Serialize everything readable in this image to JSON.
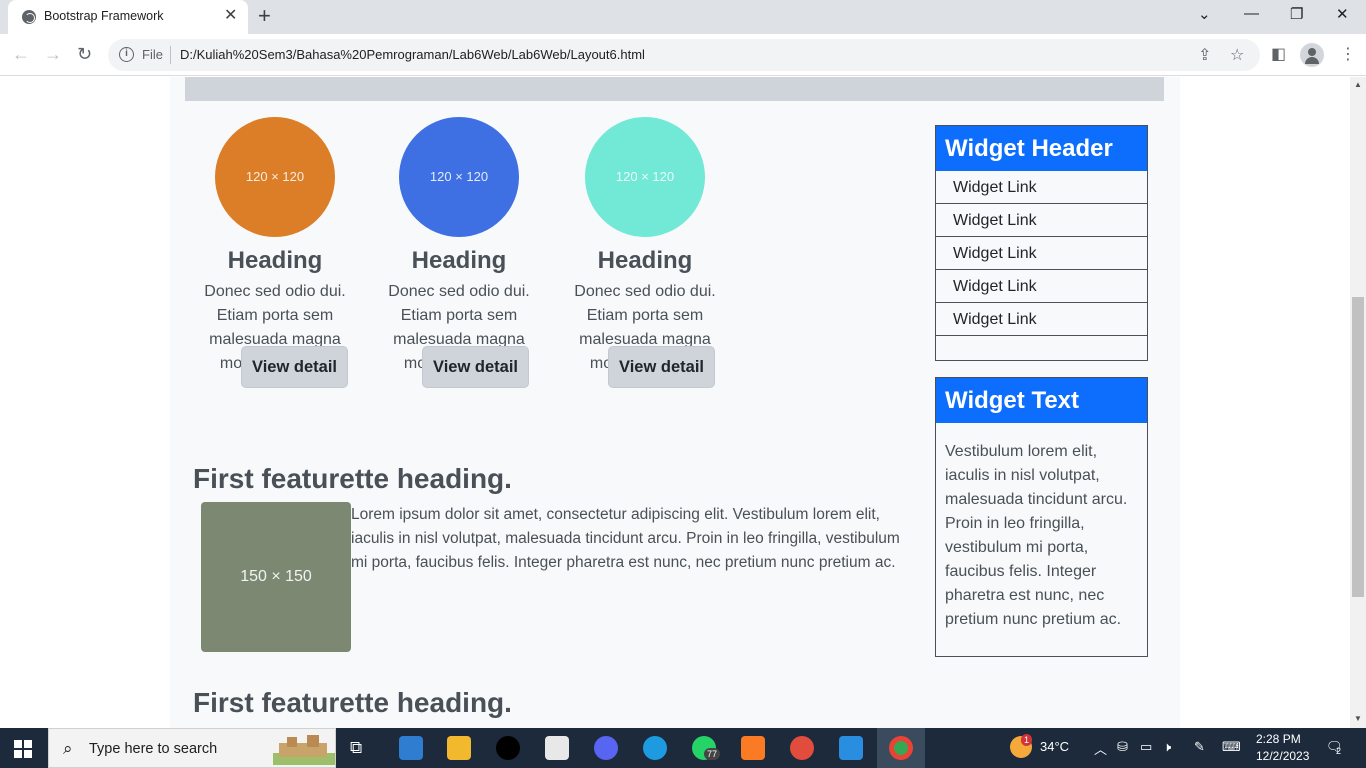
{
  "browser": {
    "tab_title": "Bootstrap Framework",
    "tab_close": "✕",
    "new_tab": "+",
    "omnibox_scheme": "File",
    "url": "D:/Kuliah%20Sem3/Bahasa%20Pemrograman/Lab6Web/Lab6Web/Layout6.html"
  },
  "features": [
    {
      "image_label": "120 × 120",
      "color": "#dc7e28",
      "heading": "Heading",
      "text": "Donec sed odio dui. Etiam porta sem malesuada magna mollis euismod.",
      "button": "View detail"
    },
    {
      "image_label": "120 × 120",
      "color": "#3f70e3",
      "heading": "Heading",
      "text": "Donec sed odio dui. Etiam porta sem malesuada magna mollis euismod.",
      "button": "View detail"
    },
    {
      "image_label": "120 × 120",
      "color": "#72e8d6",
      "heading": "Heading",
      "text": "Donec sed odio dui. Etiam porta sem malesuada magna mollis euismod.",
      "button": "View detail"
    }
  ],
  "featurette": {
    "heading": "First featurette heading.",
    "image_label": "150 × 150",
    "text": "Lorem ipsum dolor sit amet, consectetur adipiscing elit. Vestibulum lorem elit, iaculis in nisl volutpat, malesuada tincidunt arcu. Proin in leo fringilla, vestibulum mi porta, faucibus felis. Integer pharetra est nunc, nec pretium nunc pretium ac.",
    "second_heading": "First featurette heading."
  },
  "widget_links": {
    "header": "Widget Header",
    "links": [
      "Widget Link",
      "Widget Link",
      "Widget Link",
      "Widget Link",
      "Widget Link"
    ]
  },
  "widget_text": {
    "header": "Widget Text",
    "body": "Vestibulum lorem elit, iaculis in nisl volutpat, malesuada tincidunt arcu. Proin in leo fringilla, vestibulum mi porta, faucibus felis. Integer pharetra est nunc, nec pretium nunc pretium ac."
  },
  "taskbar": {
    "search_placeholder": "Type here to search",
    "temperature": "34°C",
    "weather_badge": "1",
    "whatsapp_badge": "77",
    "time": "2:28 PM",
    "date": "12/2/2023",
    "notification_count": "2"
  }
}
